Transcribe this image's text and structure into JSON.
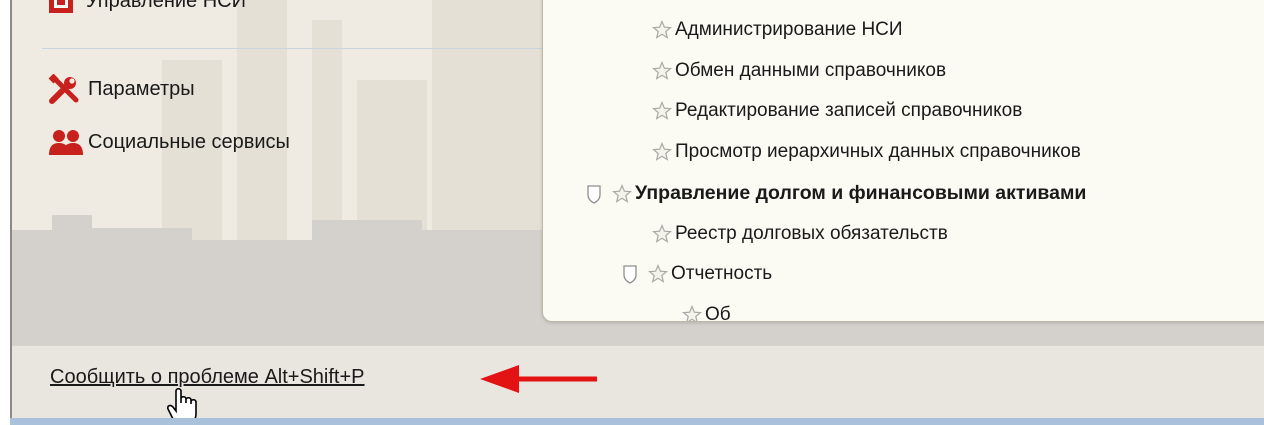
{
  "nav": {
    "top_item_label": "Управление НСИ",
    "items": [
      {
        "label": "Параметры",
        "icon": "wrench-screwdriver-icon"
      },
      {
        "label": "Социальные сервисы",
        "icon": "users-icon"
      }
    ]
  },
  "dropdown": {
    "items": [
      {
        "label": "Администрирование НСИ",
        "level": 2,
        "bold": false
      },
      {
        "label": "Обмен данными справочников",
        "level": 2,
        "bold": false
      },
      {
        "label": "Редактирование записей справочников",
        "level": 2,
        "bold": false
      },
      {
        "label": "Просмотр иерархичных данных справочников",
        "level": 2,
        "bold": false
      },
      {
        "label": "Управление долгом и финансовыми активами",
        "level": 0,
        "bold": true
      },
      {
        "label": "Реестр долговых обязательств",
        "level": 2,
        "bold": false
      },
      {
        "label": "Отчетность",
        "level": 1,
        "bold": false
      },
      {
        "label": "Об",
        "level": 3,
        "bold": false
      }
    ]
  },
  "footer": {
    "report_link": "Сообщить о проблеме Alt+Shift+P"
  },
  "colors": {
    "accent_red": "#e41313",
    "nav_icon_red": "#c8201c",
    "star_outline": "#a8a8a8"
  }
}
